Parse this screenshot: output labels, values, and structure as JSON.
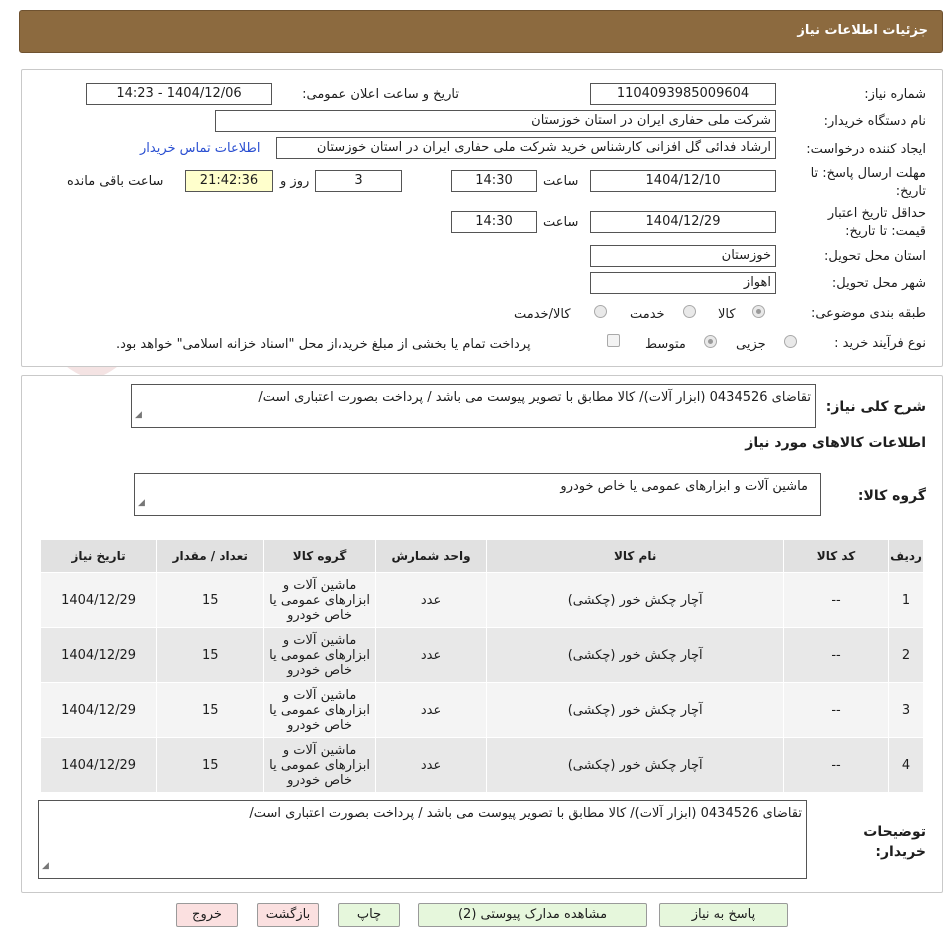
{
  "header": {
    "title": "جزئيات اطلاعات نیاز"
  },
  "watermark": {
    "text": "AriaTender.neT"
  },
  "form": {
    "need_number_label": "شماره نیاز:",
    "need_number": "1104093985009604",
    "announce_label": "تاریخ و ساعت اعلان عمومی:",
    "announce_value": "1404/12/06 - 14:23",
    "buyer_org_label": "نام دستگاه خریدار:",
    "buyer_org": "شرکت ملی حفاری ایران در استان خوزستان",
    "requester_label": "ایجاد کننده درخواست:",
    "requester": "ارشاد فدائی گل افزانی کارشناس خرید شرکت ملی حفاری ایران در استان خوزستان",
    "contact_link": "اطلاعات تماس خریدار",
    "deadline_label": "مهلت ارسال پاسخ: تا تاریخ:",
    "deadline_date": "1404/12/10",
    "time_label": "ساعت",
    "deadline_time": "14:30",
    "days_value": "3",
    "days_label": "روز و",
    "remaining_time": "21:42:36",
    "remaining_label": "ساعت باقی مانده",
    "validity_label": "حداقل تاریخ اعتبار قیمت: تا تاریخ:",
    "validity_date": "1404/12/29",
    "validity_time": "14:30",
    "province_label": "استان محل تحویل:",
    "province": "خوزستان",
    "city_label": "شهر محل تحویل:",
    "city": "اهواز",
    "category_label": "طبقه بندی موضوعی:",
    "category_options": [
      "کالا",
      "خدمت",
      "کالا/خدمت"
    ],
    "category_selected": "کالا",
    "process_label": "نوع فرآیند خرید :",
    "process_options": [
      "جزیی",
      "متوسط"
    ],
    "process_selected": "متوسط",
    "payment_note": "پرداخت تمام یا بخشی از مبلغ خرید،از محل \"اسناد خزانه اسلامی\" خواهد بود."
  },
  "details": {
    "general_desc_label": "شرح کلی نیاز:",
    "general_desc": "تقاضای 0434526 (ابزار آلات)/  کالا مطابق با تصویر پیوست می باشد / پرداخت بصورت اعتباری است/",
    "goods_info_title": "اطلاعات کالاهای مورد نیاز",
    "goods_group_label": "گروه کالا:",
    "goods_group": "ماشین آلات و ابزارهای عمومی یا خاص خودرو"
  },
  "table": {
    "headers": [
      "ردیف",
      "کد کالا",
      "نام کالا",
      "واحد شمارش",
      "گروه کالا",
      "تعداد / مقدار",
      "تاریخ نیاز"
    ],
    "rows": [
      {
        "row": "1",
        "code": "--",
        "name": "آچار چکش خور (چکشی)",
        "unit": "عدد",
        "group": "ماشین آلات و ابزارهای عمومی یا خاص خودرو",
        "qty": "15",
        "date": "1404/12/29"
      },
      {
        "row": "2",
        "code": "--",
        "name": "آچار چکش خور (چکشی)",
        "unit": "عدد",
        "group": "ماشین آلات و ابزارهای عمومی یا خاص خودرو",
        "qty": "15",
        "date": "1404/12/29"
      },
      {
        "row": "3",
        "code": "--",
        "name": "آچار چکش خور (چکشی)",
        "unit": "عدد",
        "group": "ماشین آلات و ابزارهای عمومی یا خاص خودرو",
        "qty": "15",
        "date": "1404/12/29"
      },
      {
        "row": "4",
        "code": "--",
        "name": "آچار چکش خور (چکشی)",
        "unit": "عدد",
        "group": "ماشین آلات و ابزارهای عمومی یا خاص خودرو",
        "qty": "15",
        "date": "1404/12/29"
      }
    ]
  },
  "buyer_notes": {
    "label": "توضیحات خریدار:",
    "value": "تقاضای 0434526 (ابزار آلات)/  کالا مطابق با تصویر پیوست می باشد / پرداخت بصورت اعتباری است/"
  },
  "buttons": {
    "reply": "پاسخ به نیاز",
    "attachments": "مشاهده مدارک پیوستی (2)",
    "print": "چاپ",
    "back": "بازگشت",
    "exit": "خروج"
  },
  "colors": {
    "header_bg": "#8c6a3f",
    "link": "#2a4fd1",
    "timer_bg": "#ffffcc"
  }
}
